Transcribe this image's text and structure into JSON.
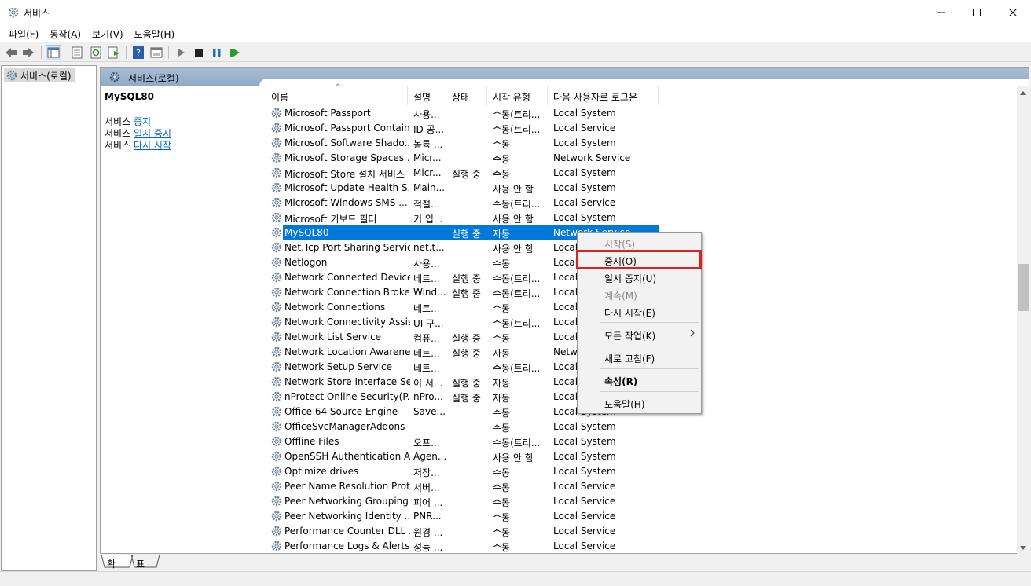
{
  "window": {
    "title": "서비스",
    "minimize_icon": "minimize-icon",
    "maximize_icon": "maximize-icon",
    "close_icon": "close-icon"
  },
  "menu": [
    "파일(F)",
    "동작(A)",
    "보기(V)",
    "도움말(H)"
  ],
  "tree": {
    "root_label": "서비스(로컬)"
  },
  "panel": {
    "header_title": "서비스(로컬)",
    "selected_service": "MySQL80",
    "action_prefix": "서비스",
    "links": {
      "stop": "중지",
      "pause": "일시 중지",
      "restart": "다시 시작"
    }
  },
  "columns": {
    "name": "이름",
    "desc": "설명",
    "status": "상태",
    "start_type": "시작 유형",
    "logon": "다음 사용자로 로그온"
  },
  "services": [
    {
      "name": "Microsoft Passport",
      "desc": "사용...",
      "status": "",
      "start": "수동(트리...",
      "logon": "Local System"
    },
    {
      "name": "Microsoft Passport Container",
      "desc": "ID 공...",
      "status": "",
      "start": "수동(트리...",
      "logon": "Local Service"
    },
    {
      "name": "Microsoft Software Shado...",
      "desc": "볼륨 ...",
      "status": "",
      "start": "수동",
      "logon": "Local System"
    },
    {
      "name": "Microsoft Storage Spaces ...",
      "desc": "Micr...",
      "status": "",
      "start": "수동",
      "logon": "Network Service"
    },
    {
      "name": "Microsoft Store 설치 서비스",
      "desc": "Micr...",
      "status": "실행 중",
      "start": "수동",
      "logon": "Local System"
    },
    {
      "name": "Microsoft Update Health S...",
      "desc": "Main...",
      "status": "",
      "start": "사용 안 함",
      "logon": "Local System"
    },
    {
      "name": "Microsoft Windows SMS ...",
      "desc": "적절...",
      "status": "",
      "start": "수동(트리...",
      "logon": "Local Service"
    },
    {
      "name": "Microsoft 키보드 필터",
      "desc": "키 입...",
      "status": "",
      "start": "사용 안 함",
      "logon": "Local System"
    },
    {
      "name": "MySQL80",
      "desc": "",
      "status": "실행 중",
      "start": "자동",
      "logon": "Network Service",
      "selected": true
    },
    {
      "name": "Net.Tcp Port Sharing Service",
      "desc": "net.t...",
      "status": "",
      "start": "사용 안 함",
      "logon": "Local Service"
    },
    {
      "name": "Netlogon",
      "desc": "사용...",
      "status": "",
      "start": "수동",
      "logon": "Local System"
    },
    {
      "name": "Network Connected Device...",
      "desc": "네트...",
      "status": "실행 중",
      "start": "수동(트리...",
      "logon": "Local Service"
    },
    {
      "name": "Network Connection Broker",
      "desc": "Wind...",
      "status": "실행 중",
      "start": "수동(트리...",
      "logon": "Local System"
    },
    {
      "name": "Network Connections",
      "desc": "네트...",
      "status": "",
      "start": "수동",
      "logon": "Local System"
    },
    {
      "name": "Network Connectivity Assis...",
      "desc": "UI 구...",
      "status": "",
      "start": "수동(트리...",
      "logon": "Local System"
    },
    {
      "name": "Network List Service",
      "desc": "컴퓨...",
      "status": "실행 중",
      "start": "수동",
      "logon": "Local Service"
    },
    {
      "name": "Network Location Awareness",
      "desc": "네트...",
      "status": "실행 중",
      "start": "자동",
      "logon": "Network Service"
    },
    {
      "name": "Network Setup Service",
      "desc": "네트...",
      "status": "",
      "start": "수동(트리...",
      "logon": "Local System"
    },
    {
      "name": "Network Store Interface Se...",
      "desc": "이 서...",
      "status": "실행 중",
      "start": "자동",
      "logon": "Local Service"
    },
    {
      "name": "nProtect Online Security(P...",
      "desc": "nPro...",
      "status": "실행 중",
      "start": "자동",
      "logon": "Local System"
    },
    {
      "name": "Office 64 Source Engine",
      "desc": "Save...",
      "status": "",
      "start": "수동",
      "logon": "Local System"
    },
    {
      "name": "OfficeSvcManagerAddons",
      "desc": "",
      "status": "",
      "start": "수동",
      "logon": "Local System"
    },
    {
      "name": "Offline Files",
      "desc": "오프...",
      "status": "",
      "start": "수동(트리...",
      "logon": "Local System"
    },
    {
      "name": "OpenSSH Authentication A...",
      "desc": "Agen...",
      "status": "",
      "start": "사용 안 함",
      "logon": "Local System"
    },
    {
      "name": "Optimize drives",
      "desc": "저장...",
      "status": "",
      "start": "수동",
      "logon": "Local System"
    },
    {
      "name": "Peer Name Resolution Prot...",
      "desc": "서버...",
      "status": "",
      "start": "수동",
      "logon": "Local Service"
    },
    {
      "name": "Peer Networking Grouping",
      "desc": "피어 ...",
      "status": "",
      "start": "수동",
      "logon": "Local Service"
    },
    {
      "name": "Peer Networking Identity ...",
      "desc": "PNR...",
      "status": "",
      "start": "수동",
      "logon": "Local Service"
    },
    {
      "name": "Performance Counter DLL ...",
      "desc": "원경 ...",
      "status": "",
      "start": "수동",
      "logon": "Local Service"
    },
    {
      "name": "Performance Logs & Alerts",
      "desc": "성능 ...",
      "status": "",
      "start": "수동",
      "logon": "Local Service"
    }
  ],
  "context_menu": {
    "start": "시작(S)",
    "stop": "중지(O)",
    "pause": "일시 중지(U)",
    "resume": "계속(M)",
    "restart": "다시 시작(E)",
    "all_tasks": "모든 작업(K)",
    "refresh": "새로 고침(F)",
    "properties": "속성(R)",
    "help": "도움말(H)"
  },
  "tabs": {
    "extended": "확장",
    "standard": "표준"
  },
  "colors": {
    "selection": "#0078d7",
    "highlight_box": "#e02020",
    "link": "#0066cc"
  }
}
